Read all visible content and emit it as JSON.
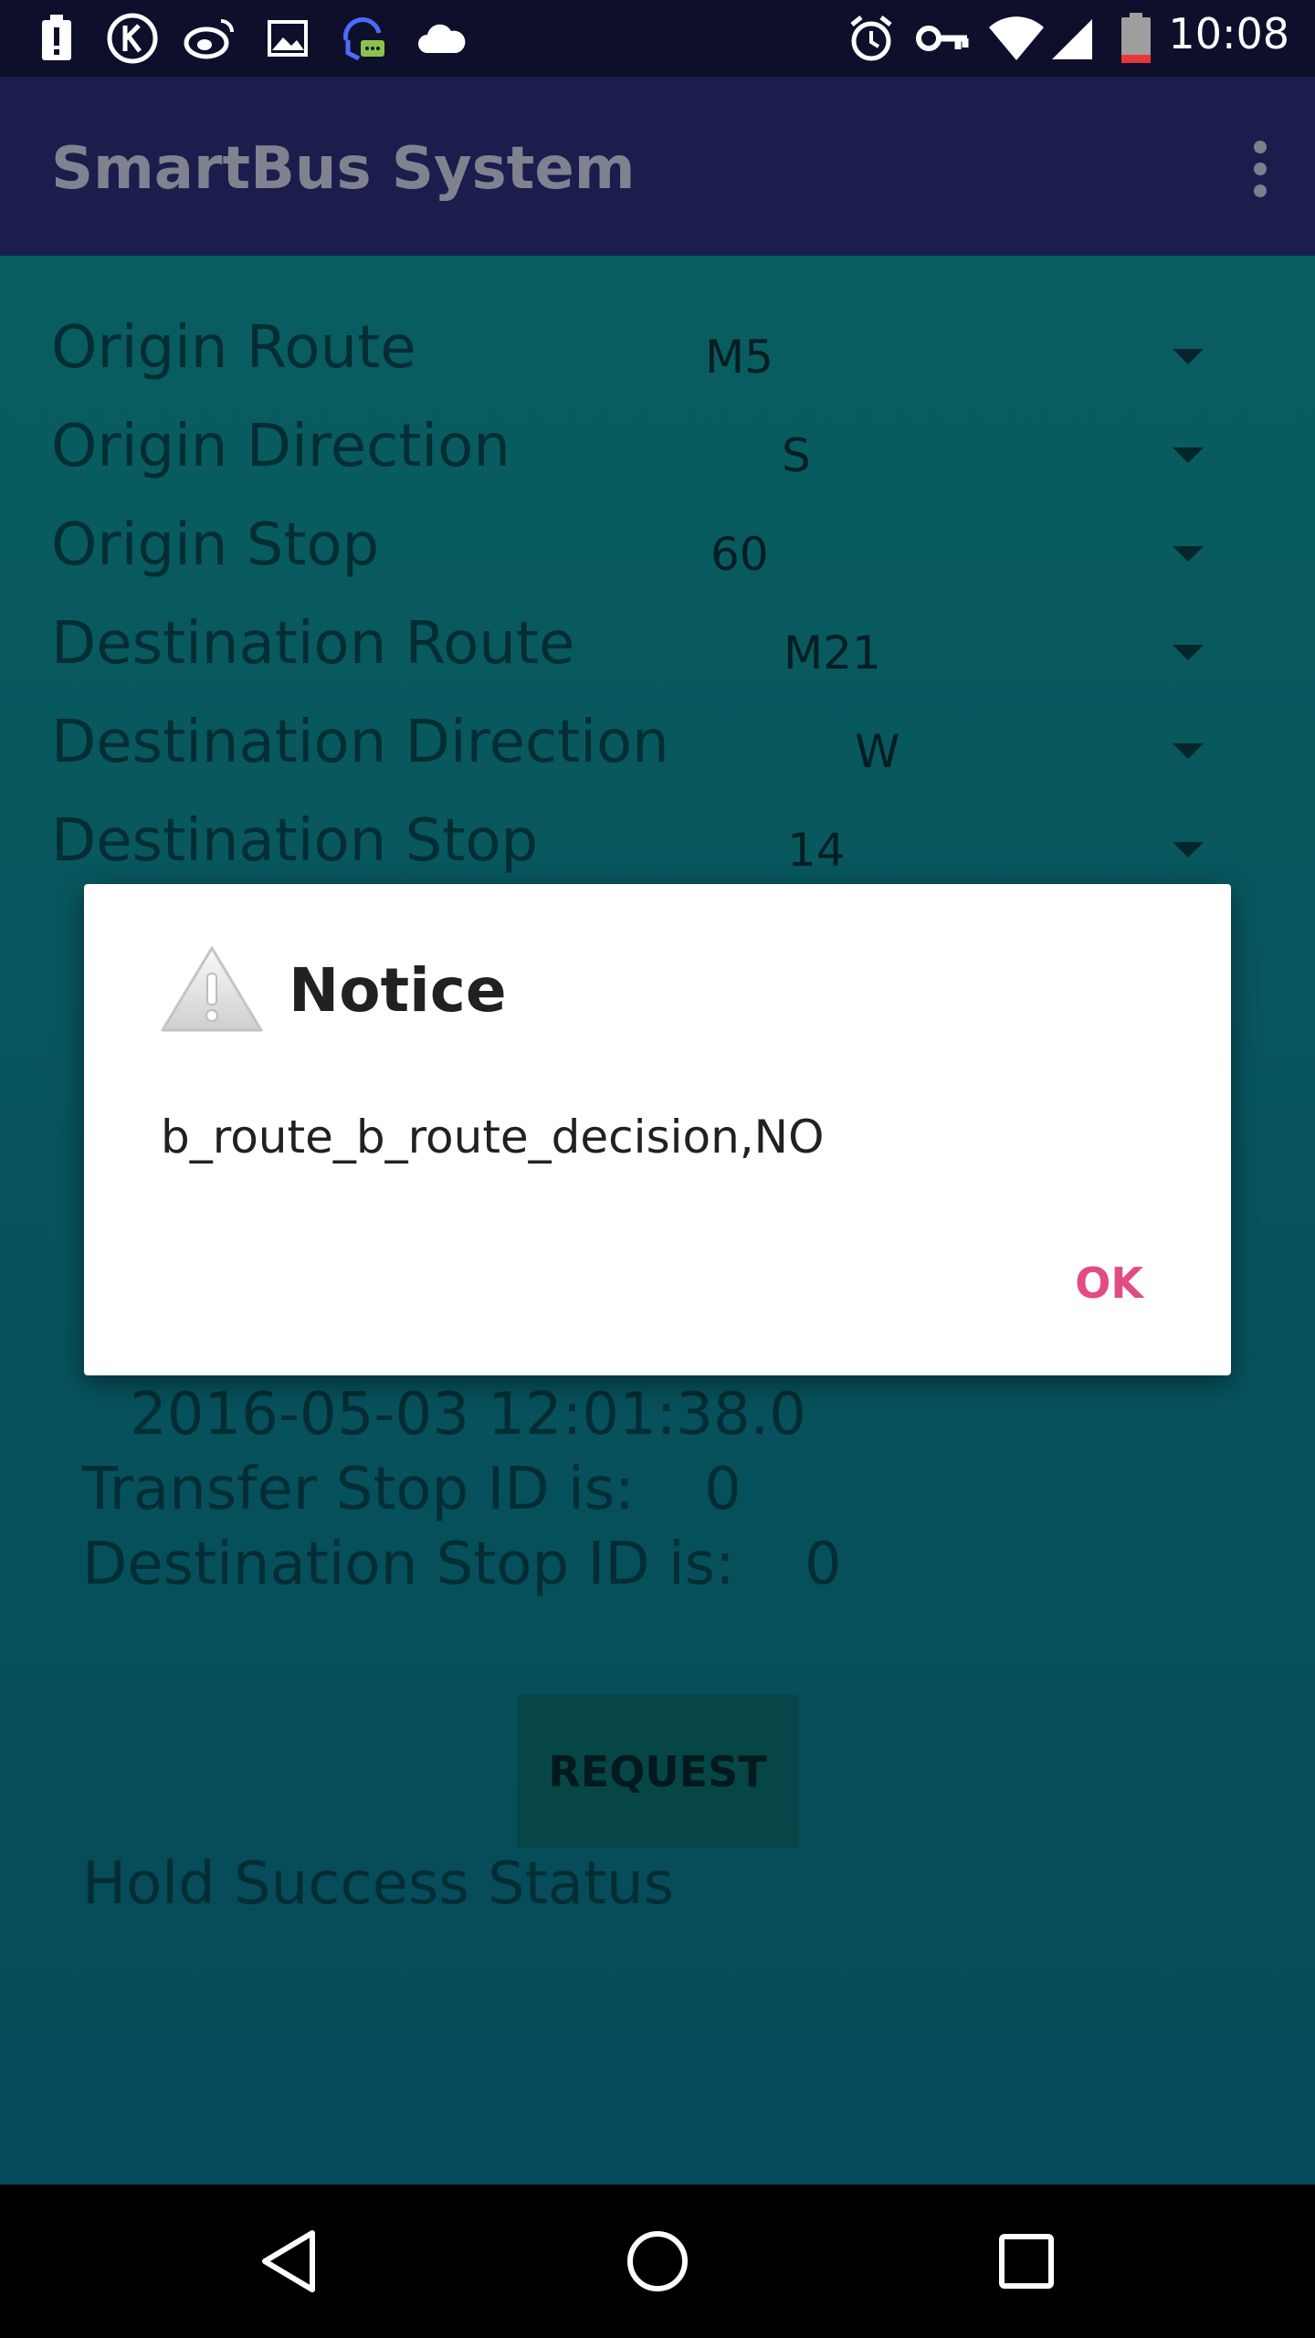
{
  "status_bar": {
    "time": "10:08",
    "left_icons": [
      "alert-battery-icon",
      "k-app-icon",
      "weibo-icon",
      "image-icon",
      "chat-bot-icon",
      "cloud-icon"
    ],
    "right_icons": [
      "alarm-icon",
      "vpn-key-icon",
      "wifi-icon",
      "signal-icon",
      "battery-low-icon"
    ]
  },
  "app_bar": {
    "title": "SmartBus System"
  },
  "form": {
    "rows": [
      {
        "label": "Origin Route",
        "value": "M5"
      },
      {
        "label": "Origin Direction",
        "value": "S"
      },
      {
        "label": "Origin Stop",
        "value": "60"
      },
      {
        "label": "Destination Route",
        "value": "M21"
      },
      {
        "label": "Destination Direction",
        "value": "W"
      },
      {
        "label": "Destination Stop",
        "value": "14"
      }
    ]
  },
  "info": {
    "timestamp": "2016-05-03 12:01:38.0",
    "transfer_stop_label": "Transfer Stop ID is:",
    "transfer_stop_value": "0",
    "destination_stop_label": "Destination Stop ID is:",
    "destination_stop_value": "0"
  },
  "request_button": "REQUEST",
  "hold_status": "Hold Success Status",
  "dialog": {
    "title": "Notice",
    "message": "b_route_b_route_decision,NO",
    "ok_label": "OK"
  },
  "colors": {
    "status_bar": "#0e0f2a",
    "app_bar": "#1b1e4c",
    "content_top": "#095e60",
    "content_bottom": "#05495a",
    "dialog_accent": "#e24b84"
  }
}
